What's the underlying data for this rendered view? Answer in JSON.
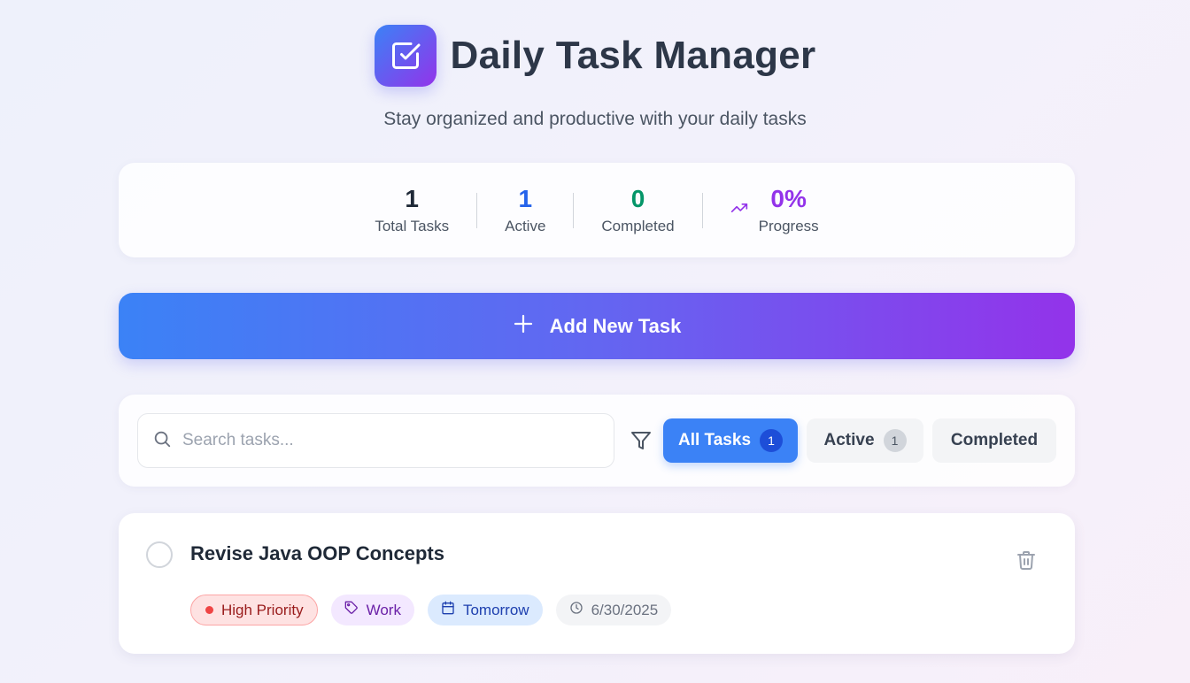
{
  "header": {
    "title": "Daily Task Manager",
    "subtitle": "Stay organized and productive with your daily tasks"
  },
  "stats": [
    {
      "value": "1",
      "label": "Total Tasks",
      "color": "#1f2937"
    },
    {
      "value": "1",
      "label": "Active",
      "color": "#2563eb"
    },
    {
      "value": "0",
      "label": "Completed",
      "color": "#059669"
    },
    {
      "value": "0%",
      "label": "Progress",
      "color": "#9333ea"
    }
  ],
  "add_button": {
    "label": "Add New Task"
  },
  "search": {
    "placeholder": "Search tasks..."
  },
  "tabs": {
    "all": {
      "label": "All Tasks",
      "count": "1"
    },
    "active": {
      "label": "Active",
      "count": "1"
    },
    "completed": {
      "label": "Completed"
    }
  },
  "tasks": [
    {
      "title": "Revise Java OOP Concepts",
      "priority": "High Priority",
      "category": "Work",
      "due": "Tomorrow",
      "date": "6/30/2025"
    }
  ],
  "colors": {
    "accent": "#3b82f6",
    "gradient_start": "#3b82f6",
    "gradient_end": "#9333ea"
  }
}
